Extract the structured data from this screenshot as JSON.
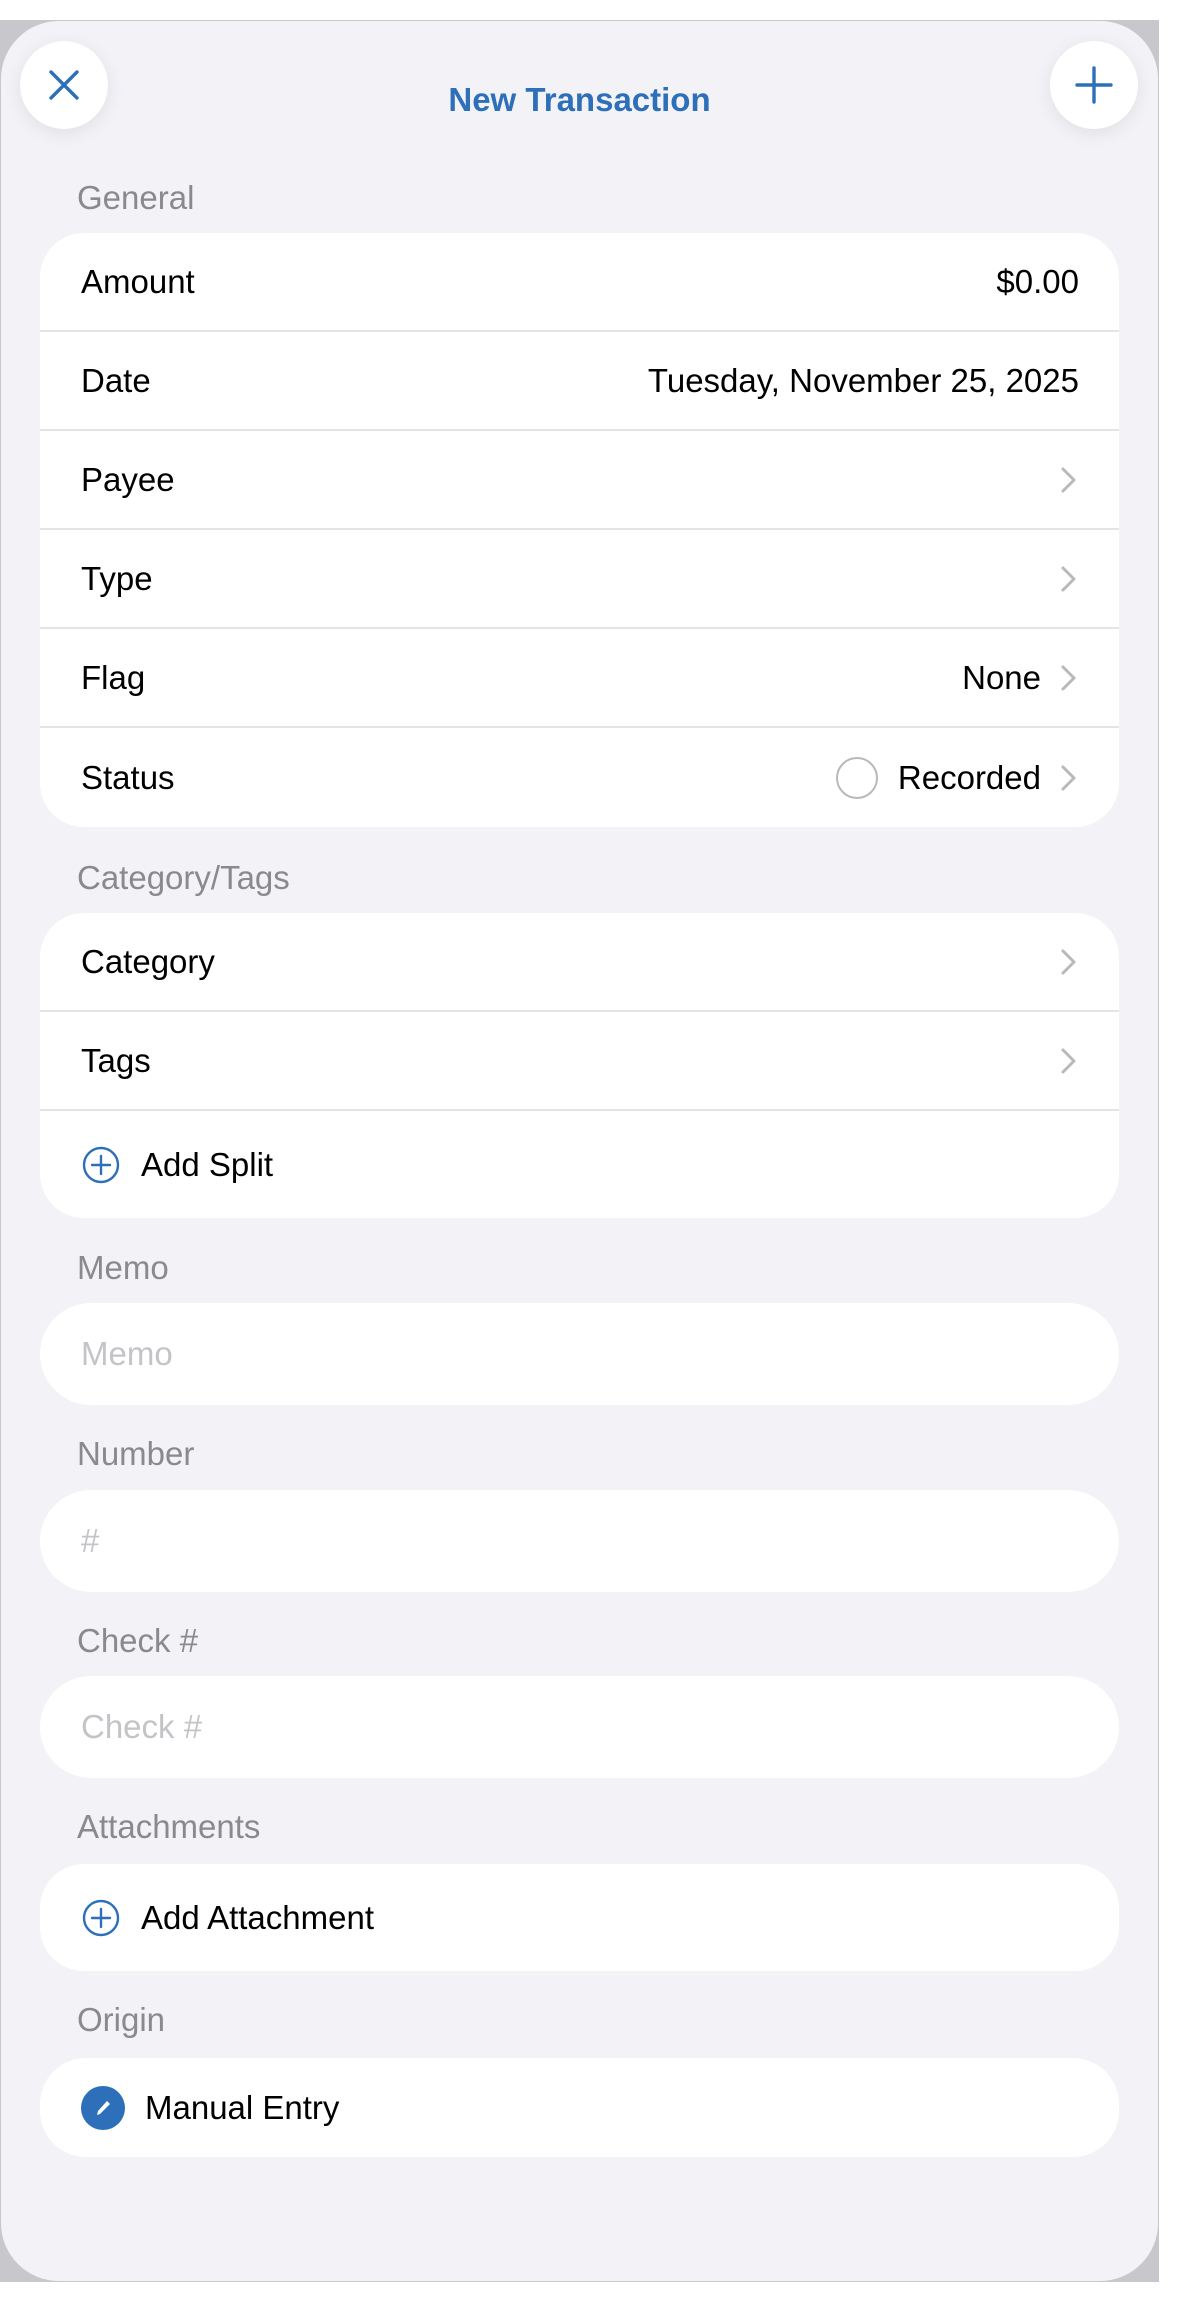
{
  "header": {
    "title": "New Transaction",
    "close_icon": "close-icon",
    "add_icon": "plus-icon"
  },
  "general": {
    "label": "General",
    "rows": [
      {
        "label": "Amount",
        "value": "$0.00"
      },
      {
        "label": "Date",
        "value": "Tuesday, November 25, 2025"
      },
      {
        "label": "Payee",
        "value": ""
      },
      {
        "label": "Type",
        "value": ""
      },
      {
        "label": "Flag",
        "value": "None"
      },
      {
        "label": "Status",
        "value": "Recorded"
      }
    ]
  },
  "category_tags": {
    "label": "Category/Tags",
    "rows": [
      {
        "label": "Category"
      },
      {
        "label": "Tags"
      }
    ],
    "add_split": "Add Split"
  },
  "memo": {
    "label": "Memo",
    "placeholder": "Memo"
  },
  "number": {
    "label": "Number",
    "placeholder": "#"
  },
  "check": {
    "label": "Check #",
    "placeholder": "Check #"
  },
  "attachments": {
    "label": "Attachments",
    "add": "Add Attachment"
  },
  "origin": {
    "label": "Origin",
    "value": "Manual Entry",
    "icon": "pencil-icon"
  },
  "colors": {
    "accent": "#2d6fb8",
    "background": "#f2f2f7",
    "secondary_text": "#8a8a8e"
  }
}
